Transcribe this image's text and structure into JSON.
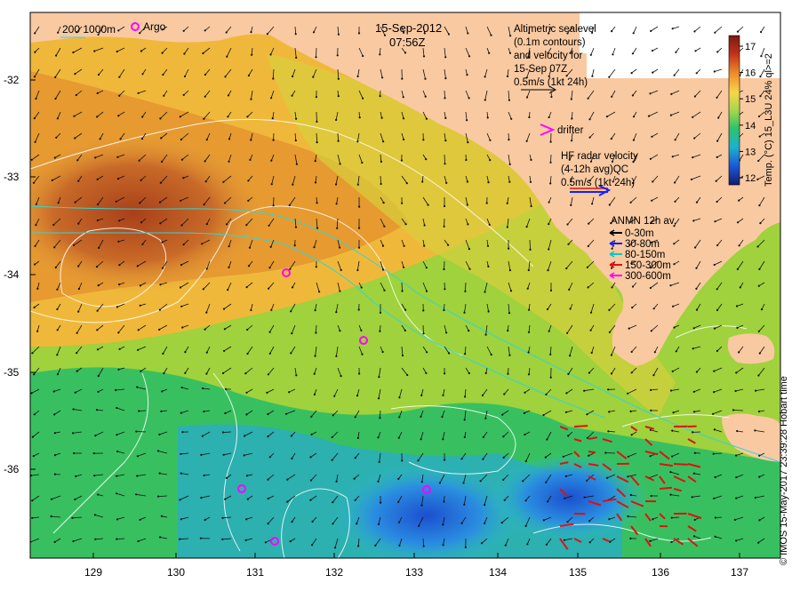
{
  "map": {
    "date": "15-Sep-2012",
    "time": "07:56Z",
    "scale_bar_label": "200  1000m",
    "argo_label": "Argo",
    "altimetry_text": [
      "Altimetric sealevel",
      "(0.1m contours)",
      "and velocity for",
      "15-Sep 07Z",
      "0.5m/s (1kt 24h)"
    ],
    "drifter_label": "drifter",
    "hf_radar_text": [
      "HF radar velocity",
      "(4-12h avg)QC",
      "0.5m/s (1kt 24h)"
    ],
    "anmn": {
      "title": "ANMN 12h av.",
      "items": [
        {
          "label": "0-30m",
          "color": "#000000"
        },
        {
          "label": "30-80m",
          "color": "#1a1aff"
        },
        {
          "label": "80-150m",
          "color": "#00c8c8"
        },
        {
          "label": "150-300m",
          "color": "#e01010"
        },
        {
          "label": "300-600m",
          "color": "#ff00ff"
        }
      ]
    },
    "colorbar": {
      "label": "Temp. (°C) 15_L3U 24% ql>=2",
      "ticks": [
        "17",
        "16",
        "15",
        "14",
        "13",
        "12"
      ]
    },
    "copyright": "© IMOS 15-May-2017 23:39:28 Hobart time",
    "x_ticks": [
      "129",
      "130",
      "131",
      "132",
      "133",
      "134",
      "135",
      "136",
      "137"
    ],
    "y_ticks": [
      "-32",
      "-33",
      "-34",
      "-35",
      "-36"
    ],
    "colors": {
      "land": "#f9c9a1",
      "argo": "#ff00ff",
      "drifter": "#ff00ff",
      "hf_radar": "#1020ff",
      "hf_radar_shadow": "#e01010"
    }
  }
}
